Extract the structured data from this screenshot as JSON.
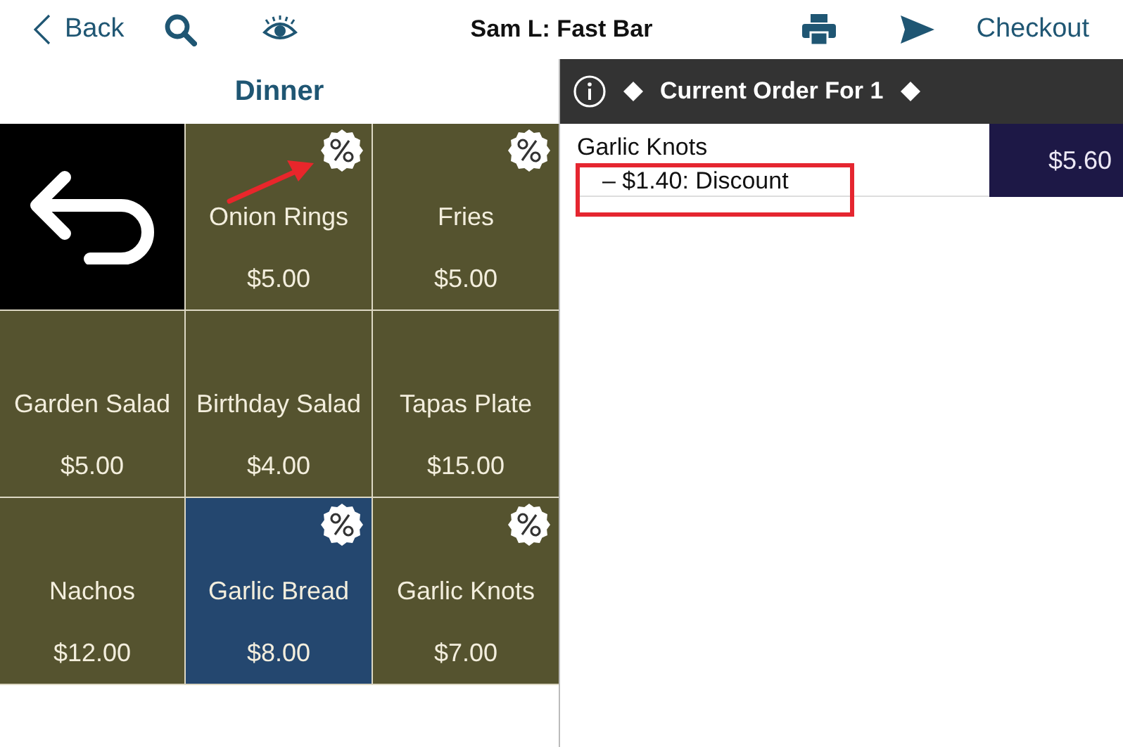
{
  "top_bar": {
    "back": "Back",
    "title": "Sam L: Fast Bar",
    "checkout": "Checkout"
  },
  "menu": {
    "category": "Dinner",
    "tiles": [
      {
        "kind": "back"
      },
      {
        "kind": "item",
        "name": "Onion Rings",
        "price": "$5.00",
        "discount": true,
        "selected": false,
        "arrow_marked": true
      },
      {
        "kind": "item",
        "name": "Fries",
        "price": "$5.00",
        "discount": true,
        "selected": false
      },
      {
        "kind": "item",
        "name": "Garden Salad",
        "price": "$5.00",
        "discount": false,
        "selected": false
      },
      {
        "kind": "item",
        "name": "Birthday Salad",
        "price": "$4.00",
        "discount": false,
        "selected": false
      },
      {
        "kind": "item",
        "name": "Tapas Plate",
        "price": "$15.00",
        "discount": false,
        "selected": false
      },
      {
        "kind": "item",
        "name": "Nachos",
        "price": "$12.00",
        "discount": false,
        "selected": false
      },
      {
        "kind": "item",
        "name": "Garlic Bread",
        "price": "$8.00",
        "discount": true,
        "selected": true
      },
      {
        "kind": "item",
        "name": "Garlic Knots",
        "price": "$7.00",
        "discount": true,
        "selected": false
      }
    ]
  },
  "order": {
    "title": "Current Order For 1",
    "lines": [
      {
        "name": "Garlic Knots",
        "modifier": "– $1.40: Discount",
        "price": "$5.60",
        "highlighted": true
      }
    ]
  }
}
